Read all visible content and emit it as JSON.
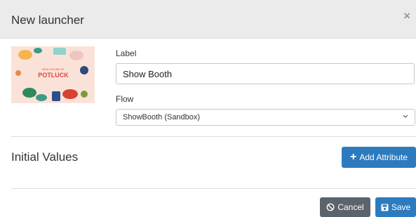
{
  "modal": {
    "title": "New launcher",
    "close_glyph": "×"
  },
  "thumbnail": {
    "title_line1": "NEW HOUSE OF",
    "title_line2": "POTLUCK"
  },
  "form": {
    "label_caption": "Label",
    "label_value": "Show Booth",
    "flow_caption": "Flow",
    "flow_selected": "ShowBooth (Sandbox)"
  },
  "initial_values": {
    "heading": "Initial Values",
    "add_button": "Add Attribute",
    "add_icon": "+"
  },
  "footer": {
    "cancel_label": "Cancel",
    "save_label": "Save"
  },
  "colors": {
    "primary": "#2c7bbf",
    "secondary": "#5b646c",
    "header_bg": "#ebebeb",
    "thumb_bg": "#fbe2d9",
    "thumb_title": "#e0463a"
  },
  "icons": {
    "close": "close-icon",
    "thumbnail": "potluck-thumbnail",
    "select": "chevron-down-icon",
    "add": "plus-icon",
    "cancel": "ban-icon",
    "save": "floppy-disk-icon"
  }
}
